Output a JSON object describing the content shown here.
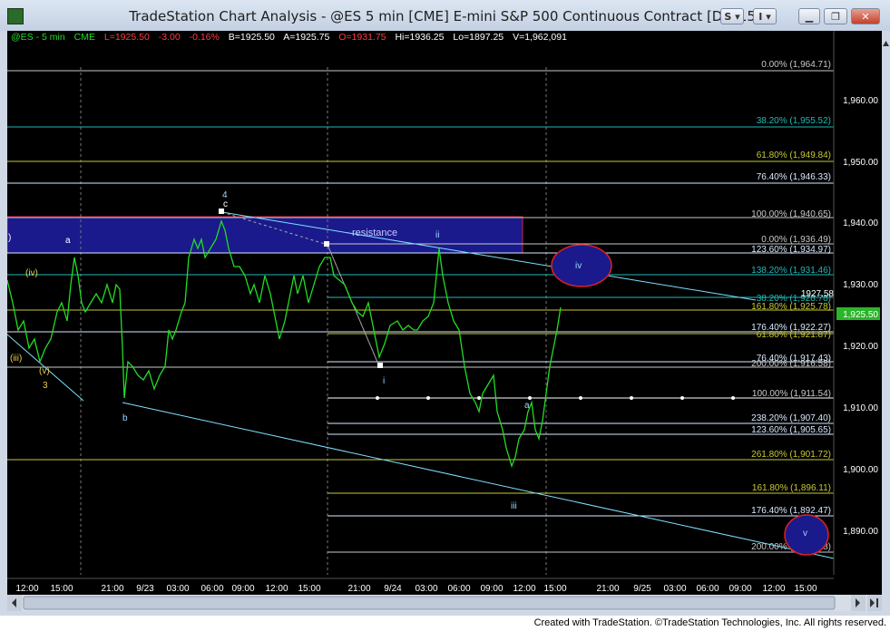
{
  "window": {
    "title": "TradeStation Chart Analysis - @ES 5 min [CME] E-mini S&P 500 Continuous Contract [Dec15]",
    "buttons": [
      "S",
      "I"
    ]
  },
  "quote": {
    "symbol": "@ES - 5 min",
    "exchange": "CME",
    "last": "L=1925.50",
    "change": "-3.00",
    "change_pct": "-0.16%",
    "bid": "B=1925.50",
    "ask": "A=1925.75",
    "open": "O=1931.75",
    "high": "Hi=1936.25",
    "low": "Lo=1897.25",
    "volume": "V=1,962,091"
  },
  "price_axis": {
    "labels": [
      "1,960.00",
      "1,950.00",
      "1,940.00",
      "1,930.00",
      "1,920.00",
      "1,910.00",
      "1,900.00",
      "1,890.00"
    ],
    "current_price": "1,925.50"
  },
  "time_axis": {
    "labels": [
      "12:00",
      "15:00",
      "21:00",
      "9/23",
      "03:00",
      "06:00",
      "09:00",
      "12:00",
      "15:00",
      "21:00",
      "9/24",
      "03:00",
      "06:00",
      "09:00",
      "12:00",
      "15:00",
      "21:00",
      "9/25",
      "03:00",
      "06:00",
      "09:00",
      "12:00",
      "15:00"
    ]
  },
  "fib_levels": [
    {
      "label": "0.00% (1,964.71)",
      "color": "#c8c8c8"
    },
    {
      "label": "38.20% (1,955.52)",
      "color": "#22b8b8"
    },
    {
      "label": "61.80% (1,949.84)",
      "color": "#c8c832"
    },
    {
      "label": "76.40% (1,946.33)",
      "color": "#d8eaff"
    },
    {
      "label": "100.00% (1,940.65)",
      "color": "#c8c8c8"
    },
    {
      "label": "0.00% (1,936.49)",
      "color": "#c8c8c8"
    },
    {
      "label": "123.60% (1,934.97)",
      "color": "#d8eaff"
    },
    {
      "label": "138.20% (1,931.46)",
      "color": "#22b8b8"
    },
    {
      "label": "38.20% (1,928.78)",
      "color": "#22b8b8"
    },
    {
      "label": "161.80% (1,925.78)",
      "color": "#c8c832"
    },
    {
      "label": "176.40% (1,922.27)",
      "color": "#d8eaff"
    },
    {
      "label": "61.80% (1,921.87)",
      "color": "#c8c832"
    },
    {
      "label": "76.40% (1,917.43)",
      "color": "#d8eaff"
    },
    {
      "label": "200.00% (1,916.58)",
      "color": "#c8c8c8"
    },
    {
      "label": "100.00% (1,911.54)",
      "color": "#c8c8c8"
    },
    {
      "label": "238.20% (1,907.40)",
      "color": "#d8eaff"
    },
    {
      "label": "123.60% (1,905.65)",
      "color": "#d8eaff"
    },
    {
      "label": "261.80% (1,901.72)",
      "color": "#c8c832"
    },
    {
      "label": "161.80% (1,896.11)",
      "color": "#c8c832"
    },
    {
      "label": "176.40% (1,892.47)",
      "color": "#d8eaff"
    },
    {
      "label": "200.00% (1,886.58)",
      "color": "#c8c8c8"
    }
  ],
  "annotations": {
    "resistance": "resistance",
    "price_tag": "1927.58",
    "wave_labels": [
      {
        "text": "4",
        "color": "#9fd8ff"
      },
      {
        "text": "c",
        "color": "#ffffff"
      },
      {
        "text": "a",
        "color": "#ffffff"
      },
      {
        "text": "b",
        "color": "#9fd8ff"
      },
      {
        "text": "(iv)",
        "color": "#e8d050"
      },
      {
        "text": "(iii)",
        "color": "#e8d050"
      },
      {
        "text": "(v)",
        "color": "#e8d050"
      },
      {
        "text": "3",
        "color": "#e8d050"
      },
      {
        "text": "ii",
        "color": "#9fd8ff"
      },
      {
        "text": "i",
        "color": "#9fd8ff"
      },
      {
        "text": "iii",
        "color": "#9fd8ff"
      },
      {
        "text": "a",
        "color": "#9fd8ff"
      },
      {
        "text": "iv",
        "color": "#9fd8ff"
      },
      {
        "text": "v",
        "color": "#9fd8ff"
      },
      {
        "text": ")",
        "color": "#ffffff"
      }
    ]
  },
  "colors": {
    "background": "#000000",
    "price_line": "#22dd22",
    "channel": "#7fe0ff",
    "resistance_box": "#1a1a8c",
    "current_price_badge": "#2ab52a"
  },
  "footer": {
    "text": "Created with TradeStation. ©TradeStation Technologies, Inc. All rights reserved."
  }
}
